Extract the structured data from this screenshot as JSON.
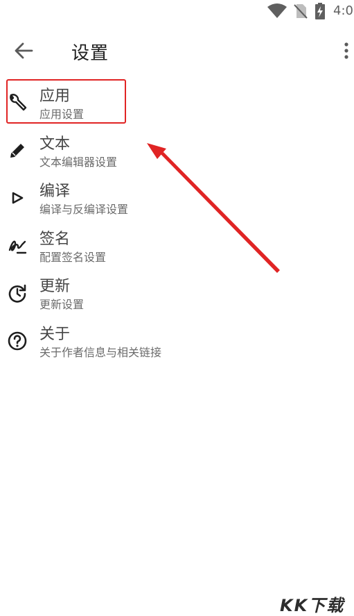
{
  "status_bar": {
    "time": "4:0"
  },
  "app_bar": {
    "title": "设置"
  },
  "items": [
    {
      "label": "应用",
      "desc": "应用设置",
      "icon": "wrench-icon"
    },
    {
      "label": "文本",
      "desc": "文本编辑器设置",
      "icon": "pencil-icon"
    },
    {
      "label": "编译",
      "desc": "编译与反编译设置",
      "icon": "play-icon"
    },
    {
      "label": "签名",
      "desc": "配置签名设置",
      "icon": "signature-icon"
    },
    {
      "label": "更新",
      "desc": "更新设置",
      "icon": "update-icon"
    },
    {
      "label": "关于",
      "desc": "关于作者信息与相关链接",
      "icon": "help-icon"
    }
  ],
  "annotation": {
    "highlight_color": "#e02424",
    "arrow_color": "#e02424"
  },
  "watermark": "KK下载"
}
